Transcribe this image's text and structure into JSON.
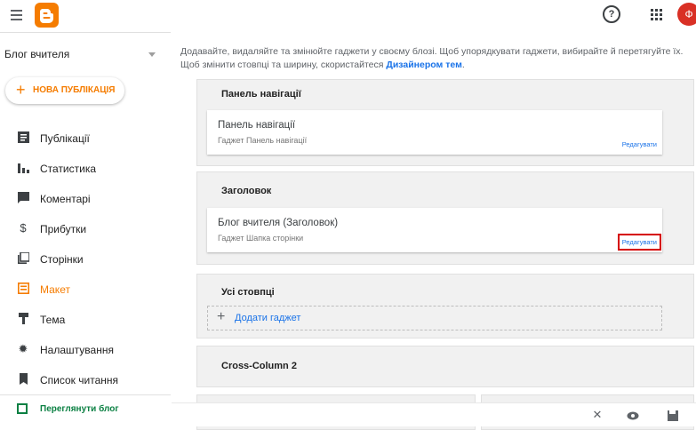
{
  "app": {
    "name": "Blogger"
  },
  "header": {
    "avatar_letter": "Ф"
  },
  "sidebar": {
    "blog_name": "Блог вчителя",
    "new_post_label": "НОВА ПУБЛІКАЦІЯ",
    "items": [
      {
        "label": "Публікації",
        "icon": "posts-icon"
      },
      {
        "label": "Статистика",
        "icon": "stats-icon"
      },
      {
        "label": "Коментарі",
        "icon": "comments-icon"
      },
      {
        "label": "Прибутки",
        "icon": "earnings-icon"
      },
      {
        "label": "Сторінки",
        "icon": "pages-icon"
      },
      {
        "label": "Макет",
        "icon": "layout-icon",
        "active": true
      },
      {
        "label": "Тема",
        "icon": "theme-icon"
      },
      {
        "label": "Налаштування",
        "icon": "settings-icon"
      },
      {
        "label": "Список читання",
        "icon": "reading-list-icon"
      }
    ],
    "view_blog_label": "Переглянути блог"
  },
  "main": {
    "intro_text": "Додавайте, видаляйте та змінюйте гаджети у своєму блозі. Щоб упорядкувати гаджети, вибирайте й перетягуйте їх. Щоб змінити стовпці та ширину, скористайтеся ",
    "intro_link": "Дизайнером тем",
    "intro_end": ".",
    "sections": {
      "navbar": {
        "title": "Панель навігації",
        "gadget_title": "Панель навігації",
        "gadget_sub": "Гаджет Панель навігації",
        "edit": "Редагувати"
      },
      "header": {
        "title": "Заголовок",
        "gadget_title": "Блог вчителя (Заголовок)",
        "gadget_sub": "Гаджет Шапка сторінки",
        "edit": "Редагувати"
      },
      "all_columns": {
        "title": "Усі стовпці",
        "add_gadget": "Додати гаджет"
      },
      "cross_column_2": {
        "title": "Cross-Column 2"
      }
    }
  },
  "colors": {
    "accent": "#f57c00",
    "link": "#1a73e8",
    "highlight": "#d50000",
    "view_blog": "#0b8043"
  }
}
